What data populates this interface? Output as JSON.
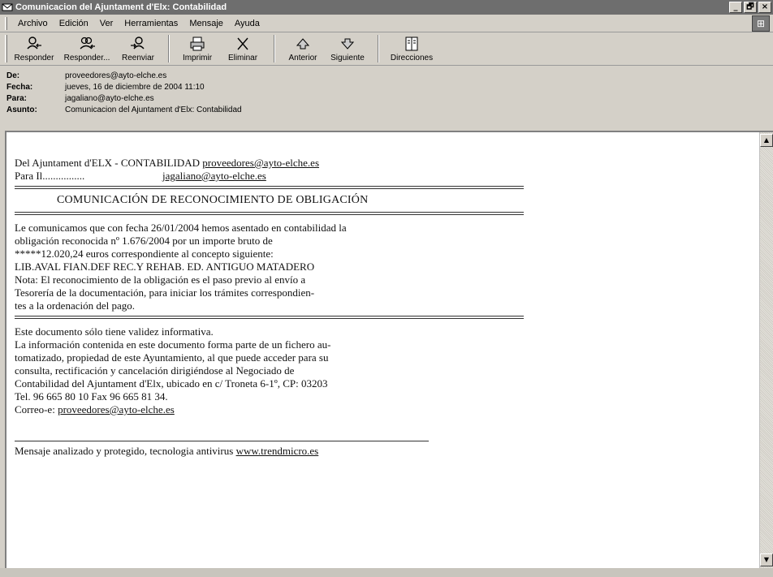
{
  "window": {
    "title": "Comunicacion del Ajuntament d'Elx: Contabilidad",
    "controls": [
      "_",
      "🗗",
      "×"
    ]
  },
  "menu": [
    "Archivo",
    "Edición",
    "Ver",
    "Herramientas",
    "Mensaje",
    "Ayuda"
  ],
  "toolbar": {
    "buttons": [
      {
        "label": "Responder",
        "icon": "reply-icon"
      },
      {
        "label": "Responder...",
        "icon": "reply-all-icon"
      },
      {
        "label": "Reenviar",
        "icon": "forward-icon"
      },
      {
        "label": "Imprimir",
        "icon": "print-icon"
      },
      {
        "label": "Eliminar",
        "icon": "delete-icon"
      },
      {
        "label": "Anterior",
        "icon": "previous-icon"
      },
      {
        "label": "Siguiente",
        "icon": "next-icon"
      },
      {
        "label": "Direcciones",
        "icon": "address-book-icon"
      }
    ]
  },
  "header": {
    "from_label": "De:",
    "from_value": "proveedores@ayto-elche.es",
    "date_label": "Fecha:",
    "date_value": "jueves, 16 de diciembre de 2004 11:10",
    "to_label": "Para:",
    "to_value": "jagaliano@ayto-elche.es",
    "subject_label": "Asunto:",
    "subject_value": "Comunicacion del Ajuntament d'Elx: Contabilidad"
  },
  "message": {
    "from_prefix": "Del Ajuntament d'ELX - CONTABILIDAD ",
    "from_email": "proveedores@ayto-elche.es",
    "to_prefix": "Para Il................",
    "to_email": "jagaliano@ayto-elche.es",
    "heading": "COMUNICACIÓN DE RECONOCIMIENTO DE OBLIGACIÓN",
    "para1": [
      "Le comunicamos que con fecha 26/01/2004 hemos asentado en contabilidad la",
      "obligación reconocida nº    1.676/2004 por un importe bruto de",
      "*****12.020,24  euros correspondiente al concepto siguiente:",
      "LIB.AVAL FIAN.DEF REC.Y REHAB. ED. ANTIGUO MATADERO",
      "Nota:  El reconocimiento de la obligación es el paso previo al envío a",
      "Tesorería de la documentación, para iniciar los trámites correspondien-",
      "tes a la ordenación del pago."
    ],
    "para2": [
      "Este documento sólo tiene validez informativa.",
      "La información contenida en este documento forma parte de un fichero au-",
      "tomatizado, propiedad de este Ayuntamiento, al que puede acceder para su",
      "consulta,  rectificación y  cancelación  dirigiéndose  al  Negociado  de",
      "Contabilidad del Ajuntament d'Elx, ubicado en c/ Troneta 6-1º, CP: 03203",
      "Tel. 96 665 80 10 Fax 96 665 81 34."
    ],
    "email_prefix": "Correo-e: ",
    "email": "proveedores@ayto-elche.es",
    "footer_prefix": "Mensaje analizado y protegido, tecnologia antivirus ",
    "footer_link": "www.trendmicro.es"
  }
}
